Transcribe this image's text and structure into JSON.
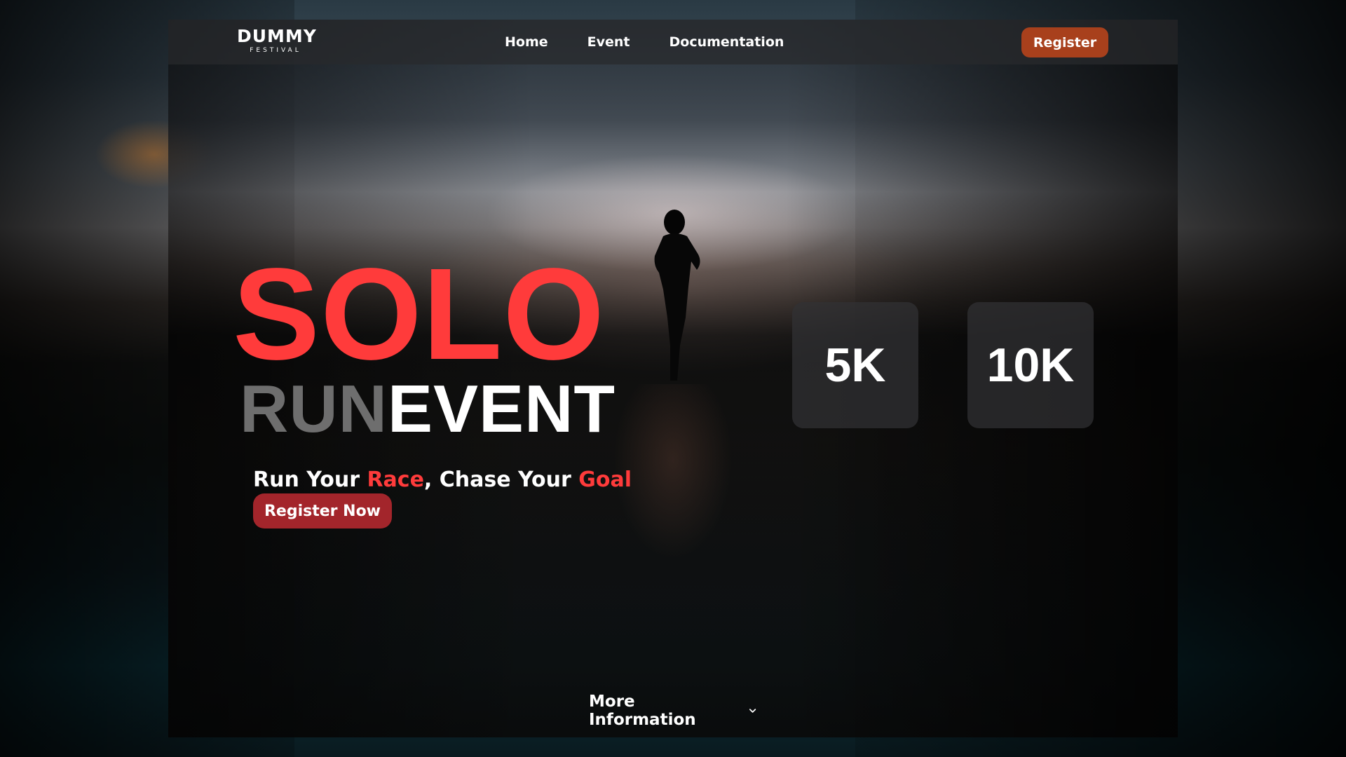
{
  "brand": {
    "name": "DUMMY",
    "subtitle": "FESTIVAL"
  },
  "nav": {
    "links": [
      {
        "label": "Home"
      },
      {
        "label": "Event"
      },
      {
        "label": "Documentation"
      }
    ],
    "register_label": "Register"
  },
  "hero": {
    "title_line1": "SOLO",
    "title_line2_part1": "RUN",
    "title_line2_part2": "EVENT",
    "tagline": {
      "part1": "Run Your ",
      "accent1": "Race",
      "part2": ", Chase Your ",
      "accent2": "Goal"
    },
    "cta_label": "Register Now"
  },
  "distances": [
    {
      "label": "5K"
    },
    {
      "label": "10K"
    }
  ],
  "footer": {
    "more_info_label": "More Information",
    "more_info_icon": "chevron-down-icon"
  },
  "colors": {
    "accent_red": "#ff3b3b",
    "register_btn": "#a8401c",
    "cta_btn": "#a3252b"
  }
}
